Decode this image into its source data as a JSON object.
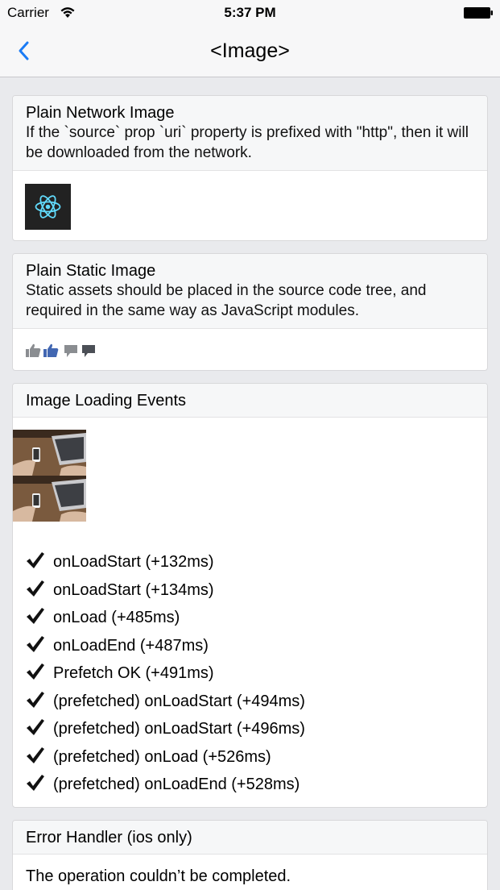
{
  "status_bar": {
    "carrier": "Carrier",
    "time": "5:37 PM"
  },
  "nav": {
    "title": "<Image>",
    "back_icon": "chevron-left-icon"
  },
  "colors": {
    "accent": "#1a7bf5",
    "background": "#e9eaed",
    "card_header": "#f6f7f8"
  },
  "sections": {
    "network": {
      "title": "Plain Network Image",
      "description": "If the `source` prop `uri` property is prefixed with \"http\", then it will be downloaded from the network."
    },
    "static": {
      "title": "Plain Static Image",
      "description": "Static assets should be placed in the source code tree, and required in the same way as JavaScript modules.",
      "icons": [
        "thumbs-up-gray-icon",
        "thumbs-up-blue-icon",
        "comment-gray-icon",
        "comment-dark-icon"
      ]
    },
    "events": {
      "title": "Image Loading Events",
      "log": [
        "onLoadStart (+132ms)",
        "onLoadStart (+134ms)",
        "onLoad (+485ms)",
        "onLoadEnd (+487ms)",
        "Prefetch OK (+491ms)",
        "(prefetched) onLoadStart (+494ms)",
        "(prefetched) onLoadStart (+496ms)",
        "(prefetched) onLoad (+526ms)",
        "(prefetched) onLoadEnd (+528ms)"
      ]
    },
    "error": {
      "title": "Error Handler (ios only)",
      "message": "The operation couldn’t be completed."
    }
  }
}
